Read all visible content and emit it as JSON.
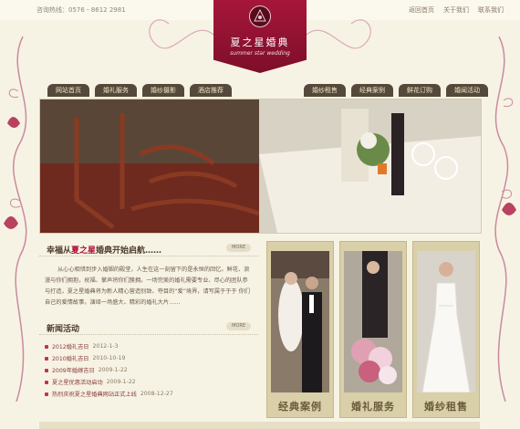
{
  "header": {
    "hotline": "咨询热线：0576 - 8612 2981",
    "links": [
      "返回首页",
      "关于我们",
      "联系我们"
    ]
  },
  "logo": {
    "name": "夏之星婚典",
    "tagline": "summer star wedding"
  },
  "nav_left": [
    "网站首页",
    "婚礼服务",
    "婚纱摄影",
    "酒店推荐"
  ],
  "nav_right": [
    "婚纱租售",
    "经典案例",
    "鲜花订购",
    "婚闻活动"
  ],
  "welcome": {
    "title_prefix": "幸福从",
    "title_highlight": "夏之星",
    "title_suffix": "婚典开始启航……",
    "more": "MORE",
    "text": "从心心相惜到步入婚姻的殿堂，人生在这一刻留下的是永恒的回忆。鲜花、浪漫与你们拥抱，祝福、掌声将你们簇拥。一场完美的婚礼需要专业、尽心的团队参与打造，夏之星婚典将为新人精心营造别致、夺目的“爱”境界，请写属于于于 你们自己的爱情故事，演绎一场盛大、精彩的婚礼大片……"
  },
  "news": {
    "title": "新闻活动",
    "more": "MORE",
    "items": [
      {
        "title": "2012婚礼吉日",
        "date": "2012-1-3"
      },
      {
        "title": "2010婚礼吉日",
        "date": "2010-10-19"
      },
      {
        "title": "2009年婚嫁吉日",
        "date": "2009-1-22"
      },
      {
        "title": "夏之星优惠活动启动",
        "date": "2009-1-22"
      },
      {
        "title": "热烈庆祝夏之星婚典网站正式上线",
        "date": "2008-12-27"
      }
    ]
  },
  "cards": [
    {
      "label": "经典案例"
    },
    {
      "label": "婚礼服务"
    },
    {
      "label": "婚纱租售"
    }
  ],
  "colors": {
    "brand": "#9b1235",
    "nav_bg": "#54493a",
    "page_bg": "#f7f3e4"
  }
}
